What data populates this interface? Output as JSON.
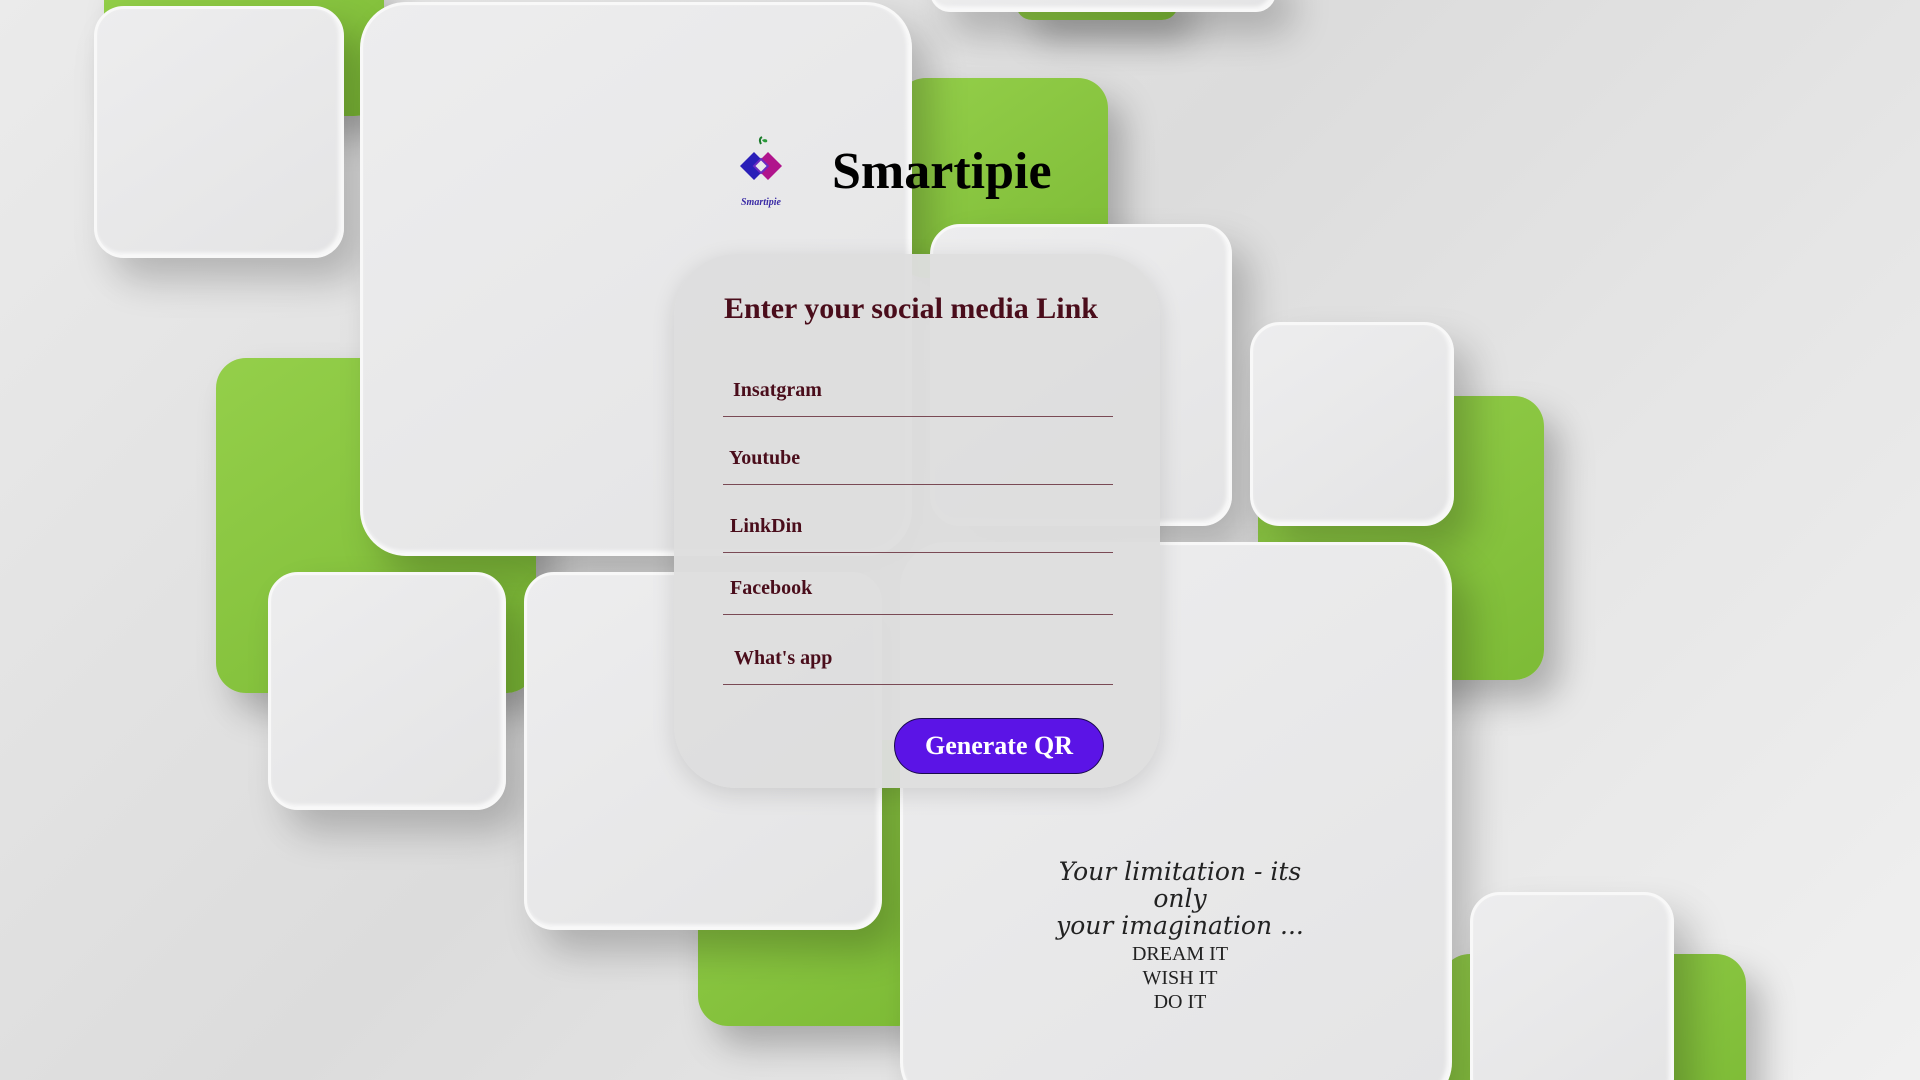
{
  "brand": {
    "name": "Smartipie",
    "logo_caption": "Smartipie",
    "logo_colors": [
      "#2a1fb8",
      "#b0148c"
    ]
  },
  "form": {
    "title": "Enter your social media Link",
    "fields": [
      {
        "placeholder": "Insatgram",
        "value": ""
      },
      {
        "placeholder": "Youtube",
        "value": ""
      },
      {
        "placeholder": "LinkDin",
        "value": ""
      },
      {
        "placeholder": "Facebook",
        "value": ""
      },
      {
        "placeholder": "What's app",
        "value": ""
      }
    ],
    "submit_label": "Generate QR"
  },
  "quote": {
    "line1": "Your limitation - its only",
    "line2": "your imagination ..."
  },
  "motto": [
    "DREAM IT",
    "WISH IT",
    "DO IT"
  ],
  "colors": {
    "accent_button": "#5b14e6",
    "title_text": "#4a0d1b",
    "green_tile": "#8cc63f",
    "gray_tile": "#e6e6e7"
  }
}
